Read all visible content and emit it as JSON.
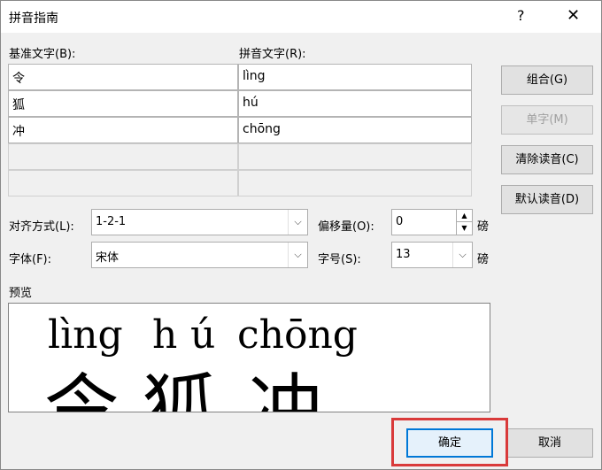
{
  "window": {
    "title": "拼音指南",
    "help": "?",
    "close": "✕"
  },
  "labels": {
    "base_text": "基准文字(B):",
    "pinyin_text": "拼音文字(R):",
    "alignment": "对齐方式(L):",
    "offset": "偏移量(O):",
    "font": "字体(F):",
    "size": "字号(S):",
    "preview": "预览",
    "unit_offset": "磅",
    "unit_size": "磅"
  },
  "rows": [
    {
      "base": "令",
      "pinyin": "lìng"
    },
    {
      "base": "狐",
      "pinyin": "hú"
    },
    {
      "base": "冲",
      "pinyin": "chōng"
    },
    {
      "base": "",
      "pinyin": ""
    },
    {
      "base": "",
      "pinyin": ""
    }
  ],
  "buttons": {
    "group": "组合(G)",
    "single": "单字(M)",
    "clear": "清除读音(C)",
    "default": "默认读音(D)",
    "ok": "确定",
    "cancel": "取消"
  },
  "fields": {
    "alignment": "1-2-1",
    "offset": "0",
    "font": "宋体",
    "size": "13"
  },
  "preview": {
    "pinyin": [
      "lìng",
      "h",
      "ú",
      "chōng"
    ],
    "chars": [
      "令",
      "狐",
      "冲"
    ]
  }
}
